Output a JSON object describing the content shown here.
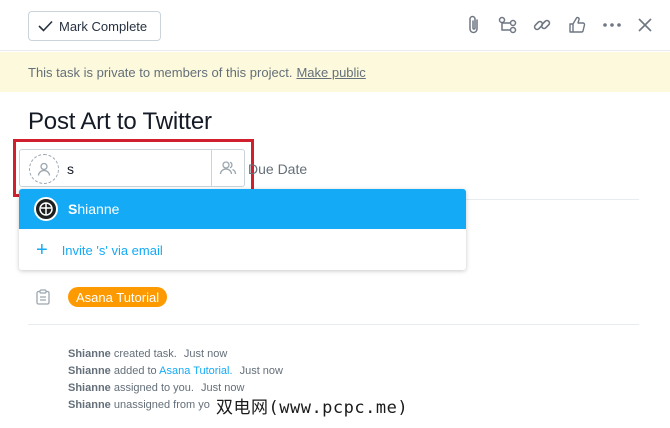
{
  "toolbar": {
    "mark_complete_label": "Mark Complete",
    "icons": [
      "paperclip-icon",
      "subtask-icon",
      "link-icon",
      "like-icon",
      "more-icon",
      "close-icon"
    ]
  },
  "privacy_bar": {
    "text": "This task is private to members of this project.",
    "link": "Make public"
  },
  "task": {
    "title": "Post Art to Twitter"
  },
  "assignee": {
    "input_value": "s",
    "due_date_label": "Due Date"
  },
  "dropdown": {
    "selected_item": {
      "highlight": "S",
      "rest": "hianne"
    },
    "invite_label": "Invite 's' via email"
  },
  "project": {
    "tag": "Asana Tutorial",
    "tag_color": "#fd9a00"
  },
  "activity": [
    {
      "who": "Shianne",
      "action": "created task.",
      "time": "Just now"
    },
    {
      "who": "Shianne",
      "action": "added to",
      "project": "Asana Tutorial.",
      "time": "Just now"
    },
    {
      "who": "Shianne",
      "action": "assigned to you.",
      "time": "Just now"
    },
    {
      "who": "Shianne",
      "action": "unassigned from yo"
    }
  ],
  "watermark": "双电网(www.pcpc.me)",
  "colors": {
    "accent": "#14aaf5",
    "private_bar": "#fcf9dc",
    "highlight_border": "#d0202e"
  }
}
